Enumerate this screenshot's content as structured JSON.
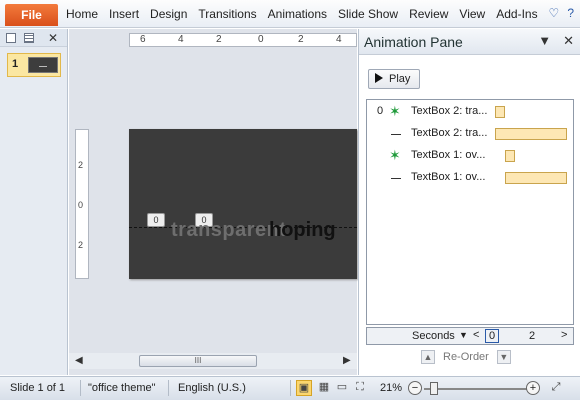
{
  "ribbon": {
    "file_label": "File",
    "tabs": [
      "Home",
      "Insert",
      "Design",
      "Transitions",
      "Animations",
      "Slide Show",
      "Review",
      "View",
      "Add-Ins"
    ],
    "icons": [
      "heart-icon",
      "help-icon"
    ]
  },
  "thumbnails": {
    "slide_number": "1"
  },
  "editor": {
    "ruler_labels": [
      "6",
      "4",
      "2",
      "0",
      "2",
      "4"
    ],
    "vruler_labels": [
      "2",
      "0",
      "2"
    ],
    "markers": [
      "0",
      "0"
    ],
    "slide_text_1": "transparent",
    "slide_text_2": "hoping",
    "scroll_mid": "III"
  },
  "animation_pane": {
    "title": "Animation Pane",
    "play_label": "Play",
    "items": [
      {
        "num": "0",
        "icon": "star-icon",
        "label": "TextBox 2: tra..."
      },
      {
        "num": "",
        "icon": "dash-icon",
        "label": "TextBox 2: tra..."
      },
      {
        "num": "",
        "icon": "star-icon",
        "label": "TextBox 1: ov..."
      },
      {
        "num": "",
        "icon": "dash-icon",
        "label": "TextBox 1: ov..."
      }
    ],
    "timeline": {
      "units_label": "Seconds",
      "start": "0",
      "mark": "2"
    },
    "reorder_label": "Re-Order"
  },
  "status": {
    "slide_info": "Slide 1 of 1",
    "theme": "\"office theme\"",
    "language": "English (U.S.)",
    "zoom": "21%"
  }
}
